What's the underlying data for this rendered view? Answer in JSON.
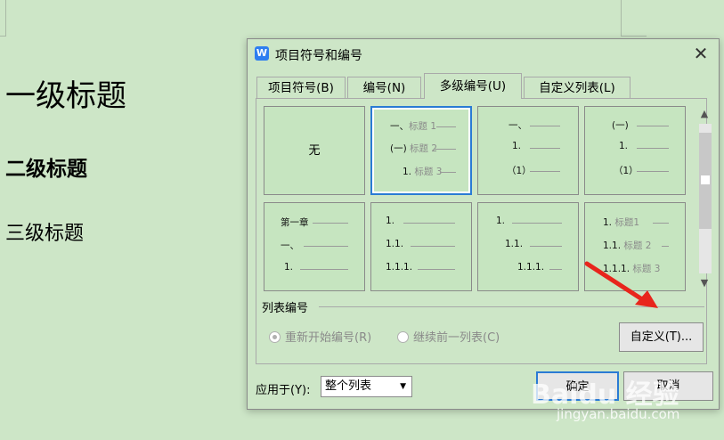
{
  "document": {
    "heading1": "一级标题",
    "heading2": "二级标题",
    "heading3": "三级标题"
  },
  "dialog": {
    "icon_letter": "W",
    "title": "项目符号和编号",
    "close": "✕",
    "tabs": [
      {
        "label": "项目符号(B)"
      },
      {
        "label": "编号(N)"
      },
      {
        "label": "多级编号(U)",
        "active": true
      },
      {
        "label": "自定义列表(L)"
      }
    ],
    "gallery": {
      "none_label": "无",
      "cell2": [
        "一、",
        "标题 1",
        "(一)",
        "标题 2",
        "1.",
        "标题 3"
      ],
      "cell3": [
        "一、",
        "1.",
        "（1）"
      ],
      "cell4": [
        "(一)",
        "1.",
        "（1）"
      ],
      "cell5": [
        "第一章",
        "一、",
        "1."
      ],
      "cell6": [
        "1.",
        "1.1.",
        "1.1.1."
      ],
      "cell7": [
        "1.",
        "1.1.",
        "1.1.1."
      ],
      "cell8": [
        "1.",
        "标题1",
        "1.1.",
        "标题 2",
        "1.1.1.",
        "标题 3"
      ]
    },
    "scroll_up": "▲",
    "scroll_down": "▼",
    "section_label": "列表编号",
    "radio_restart": "重新开始编号(R)",
    "radio_continue": "继续前一列表(C)",
    "customize_button": "自定义(T)...",
    "apply_label": "应用于(Y):",
    "apply_value": "整个列表",
    "ok_button": "确定",
    "cancel_button": "取消"
  },
  "watermark": {
    "brand": "Baidu 经验",
    "url": "jingyan.baidu.com"
  },
  "colors": {
    "background": "#cde6c7",
    "accent": "#2a7bd4",
    "annotation_arrow": "#e8251c"
  }
}
